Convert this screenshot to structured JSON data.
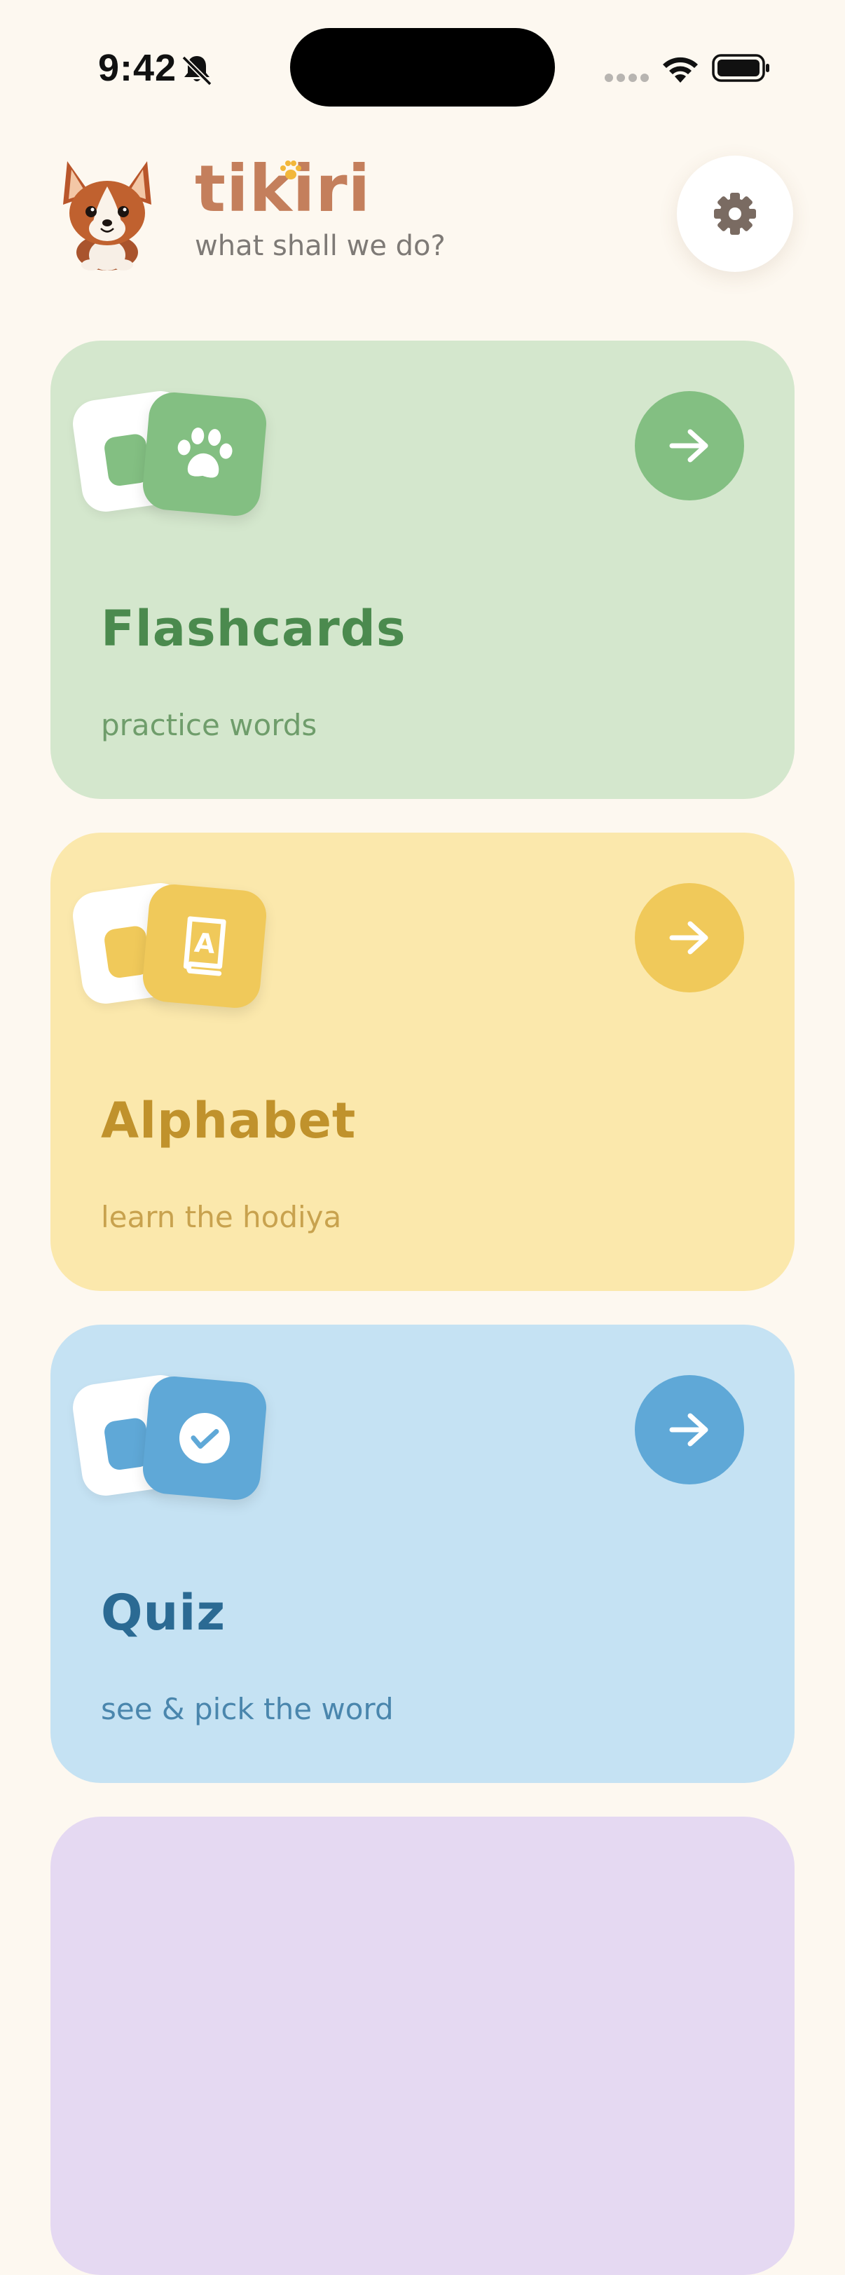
{
  "status_bar": {
    "time": "9:42"
  },
  "header": {
    "brand": "tikiri",
    "subtitle": "what shall we do?"
  },
  "cards": [
    {
      "title": "Flashcards",
      "subtitle": "practice words",
      "icon": "paw-icon",
      "accent": "#83bf82",
      "background": "#d4e7cd"
    },
    {
      "title": "Alphabet",
      "subtitle": "learn the hodiya",
      "icon": "alphabet-book-icon",
      "accent": "#f0c95a",
      "background": "#fbe8ac"
    },
    {
      "title": "Quiz",
      "subtitle": "see & pick the word",
      "icon": "check-circle-icon",
      "accent": "#5fa8d7",
      "background": "#c5e2f3"
    }
  ],
  "colors": {
    "page_background": "#fdf8f0",
    "brand": "#c47f5c"
  }
}
